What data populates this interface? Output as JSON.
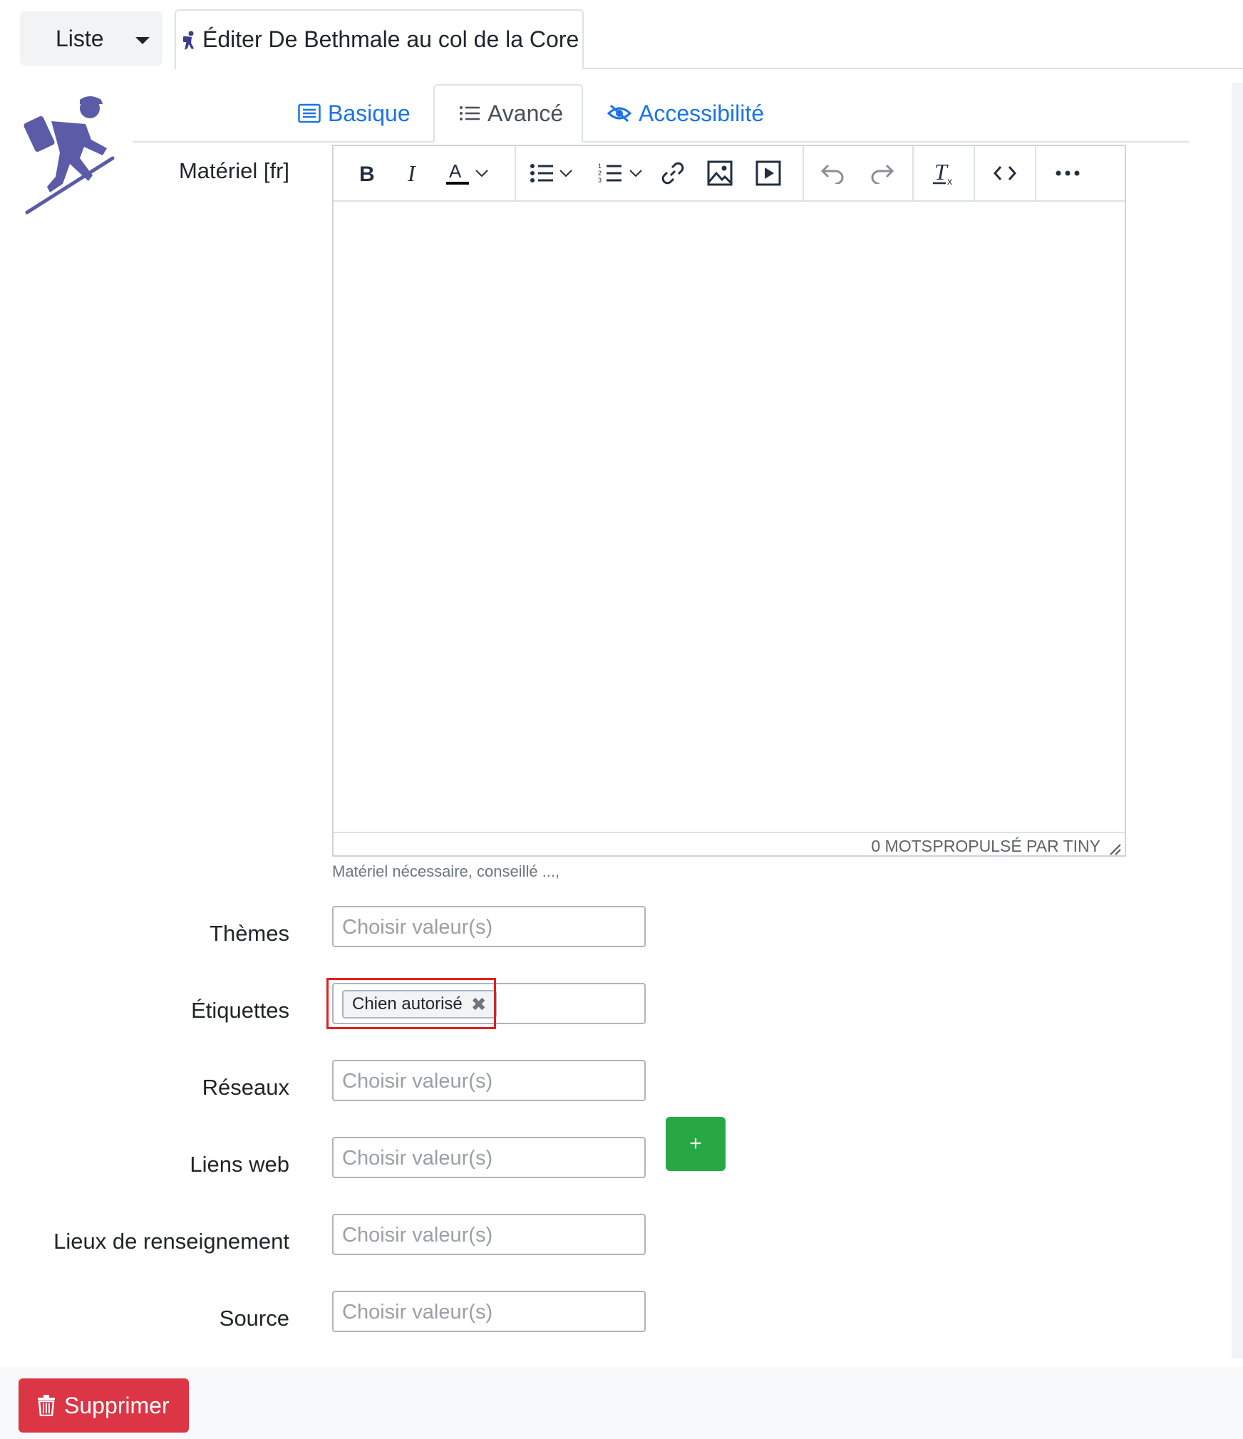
{
  "top_tabs": {
    "list_label": "Liste",
    "edit_label": "Éditer De Bethmale au col de la Core"
  },
  "inner_tabs": [
    {
      "label": "Basique"
    },
    {
      "label": "Avancé"
    },
    {
      "label": "Accessibilité"
    }
  ],
  "fields": {
    "material": {
      "label": "Matériel [fr]",
      "help": "Matériel nécessaire, conseillé ...,",
      "word_count": "0 MOTS",
      "powered_by": "PROPULSÉ PAR TINY"
    },
    "themes": {
      "label": "Thèmes",
      "placeholder": "Choisir valeur(s)"
    },
    "labels": {
      "label": "Étiquettes",
      "chip": "Chien autorisé"
    },
    "networks": {
      "label": "Réseaux",
      "placeholder": "Choisir valeur(s)"
    },
    "web_links": {
      "label": "Liens web",
      "placeholder": "Choisir valeur(s)",
      "add_label": "+"
    },
    "info_places": {
      "label": "Lieux de renseignement",
      "placeholder": "Choisir valeur(s)"
    },
    "source": {
      "label": "Source",
      "placeholder": "Choisir valeur(s)"
    }
  },
  "footer": {
    "delete_label": "Supprimer"
  },
  "colors": {
    "link_blue": "#1a73e8",
    "danger": "#dc3545",
    "success": "#28a745",
    "logo_purple": "#5b5ba8",
    "highlight_red": "#e02020"
  },
  "icons": [
    "caret-down-icon",
    "hiker-icon",
    "list-icon",
    "list-ul-icon",
    "eye-slash-icon",
    "bold-icon",
    "italic-icon",
    "text-color-icon",
    "bullet-list-icon",
    "numbered-list-icon",
    "link-icon",
    "image-icon",
    "media-icon",
    "undo-icon",
    "redo-icon",
    "remove-format-icon",
    "code-icon",
    "more-icon",
    "close-icon",
    "trash-icon",
    "resize-handle-icon"
  ]
}
